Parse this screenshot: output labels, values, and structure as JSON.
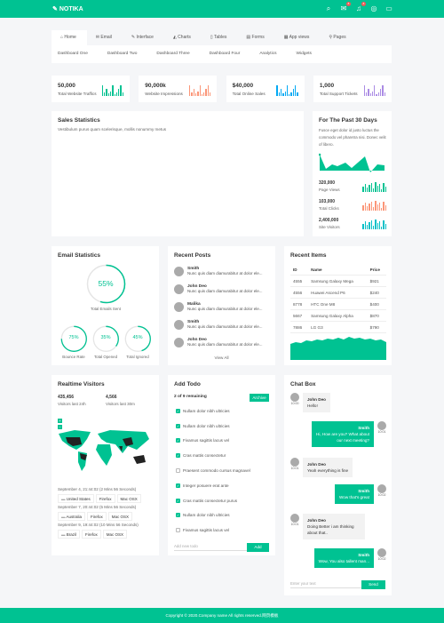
{
  "brand": "NOTIKA",
  "header": {
    "icons": [
      "search-icon",
      "mail-icon",
      "bell-icon",
      "help-icon",
      "chat-icon"
    ],
    "mail_badge": "8",
    "bell_badge": "8"
  },
  "tabs": [
    {
      "label": "Home",
      "icon": "home-icon"
    },
    {
      "label": "Email",
      "icon": "mail-icon"
    },
    {
      "label": "Interface",
      "icon": "edit-icon"
    },
    {
      "label": "Charts",
      "icon": "chart-icon"
    },
    {
      "label": "Tables",
      "icon": "table-icon"
    },
    {
      "label": "Forms",
      "icon": "form-icon"
    },
    {
      "label": "App views",
      "icon": "grid-icon"
    },
    {
      "label": "Pages",
      "icon": "page-icon"
    }
  ],
  "subnav": [
    "Dashboard One",
    "Dashboard Two",
    "Dashboard Three",
    "Dashboard Four",
    "Analytics",
    "Widgets"
  ],
  "stats": [
    {
      "value": "50,000",
      "label": "Total Website Traffics",
      "color": "#00c292"
    },
    {
      "value": "90,000k",
      "label": "Website Impressions",
      "color": "#fb9678"
    },
    {
      "value": "$40,000",
      "label": "Total Online Sales",
      "color": "#03a9f3"
    },
    {
      "value": "1,000",
      "label": "Total Support Tickets",
      "color": "#ab8ce4"
    }
  ],
  "sales": {
    "title": "Sales Statistics",
    "subtitle": "Vestibulum purus quam scelerisque, mollis nonummy metus"
  },
  "past30": {
    "title": "For The Past 30 Days",
    "text": "Fusce eget dolor id justo luctus the commodo vel pharetra nisi. Donec velit of libero.",
    "items": [
      {
        "value": "320,000",
        "label": "Page Views",
        "color": "#00c292"
      },
      {
        "value": "103,000",
        "label": "Total Clicks",
        "color": "#fb9678"
      },
      {
        "value": "2,400,000",
        "label": "Site Visitors",
        "color": "#01c0c8"
      }
    ]
  },
  "email_stats": {
    "title": "Email Statistics",
    "main": {
      "value": "55%",
      "label": "Total Emails Sent",
      "pct": 55
    },
    "small": [
      {
        "value": "75%",
        "label": "Bounce Rate",
        "pct": 75
      },
      {
        "value": "35%",
        "label": "Total Opened",
        "pct": 35
      },
      {
        "value": "45%",
        "label": "Total Ignored",
        "pct": 45
      }
    ]
  },
  "posts": {
    "title": "Recent Posts",
    "items": [
      {
        "name": "Smith",
        "text": "Nunc quis diam diamurabitur at dolor ele..."
      },
      {
        "name": "John Deo",
        "text": "Nunc quis diam diamurabitur at dolor ele..."
      },
      {
        "name": "Malika",
        "text": "Nunc quis diam diamurabitur at dolor ele..."
      },
      {
        "name": "Smith",
        "text": "Nunc quis diam diamurabitur at dolor ele..."
      },
      {
        "name": "John Deo",
        "text": "Nunc quis diam diamurabitur at dolor ele..."
      }
    ],
    "view_all": "View All"
  },
  "items": {
    "title": "Recent Items",
    "headers": [
      "ID",
      "Name",
      "Price"
    ],
    "rows": [
      [
        "4555",
        "Samsung Galaxy Mega",
        "$921"
      ],
      [
        "4556",
        "Huawei Ascend P6",
        "$240"
      ],
      [
        "8778",
        "HTC One M8",
        "$400"
      ],
      [
        "5667",
        "Samsung Galaxy Alpha",
        "$870"
      ],
      [
        "7886",
        "LG G3",
        "$790"
      ]
    ]
  },
  "visitors": {
    "title": "Realtime Visitors",
    "stats": [
      {
        "value": "435,456",
        "label": "Visitors last 24h"
      },
      {
        "value": "4,566",
        "label": "Visitors last 30m"
      }
    ],
    "zoom_in": "+",
    "zoom_out": "−",
    "log": [
      {
        "time": "September 4, 21:44:02 (2 Mins 56 Seconds)",
        "country": "United States",
        "browser": "Firefox",
        "os": "Mac OSX"
      },
      {
        "time": "September 7, 20:44:02 (5 Mins 56 Seconds)",
        "country": "Australia",
        "browser": "Firefox",
        "os": "Mac OSX"
      },
      {
        "time": "September 9, 19:44:02 (10 Mins 56 Seconds)",
        "country": "Brazil",
        "browser": "Firefox",
        "os": "Mac OSX"
      }
    ]
  },
  "todo": {
    "title": "Add Todo",
    "remaining": "2 of 9 remaining",
    "archive": "Archive",
    "items": [
      {
        "text": "Nullam dolor nibh ultricies",
        "done": true
      },
      {
        "text": "Nullam dolor nibh ultricies",
        "done": true
      },
      {
        "text": "Fivamus sagittis lacus vel",
        "done": true
      },
      {
        "text": "Cras mattis consectetur",
        "done": true
      },
      {
        "text": "Praesent commodo cursus magnavel",
        "done": false
      },
      {
        "text": "Integer posuere erat ante",
        "done": true
      },
      {
        "text": "Cras mattis consectetur purus",
        "done": true
      },
      {
        "text": "Nullam dolor nibh ultricies",
        "done": true
      },
      {
        "text": "Fivamus sagittis lacus vel",
        "done": false
      }
    ],
    "placeholder": "Add new todo",
    "add": "Add"
  },
  "chat": {
    "title": "Chat Box",
    "messages": [
      {
        "from": "John Deo",
        "text": "Hello!",
        "time": "10:00",
        "side": "in"
      },
      {
        "from": "Smith",
        "text": "Hi, How are you? What about our next meeting?",
        "time": "10:01",
        "side": "out"
      },
      {
        "from": "John Deo",
        "text": "Yeah everything is fine",
        "time": "10:01",
        "side": "in"
      },
      {
        "from": "Smith",
        "text": "Wow that's great",
        "time": "10:02",
        "side": "out"
      },
      {
        "from": "John Deo",
        "text": "Doing Better i am thinking about that..",
        "time": "10:01",
        "side": "in"
      },
      {
        "from": "Smith",
        "text": "Wow, You also tallent man...",
        "time": "10:02",
        "side": "out"
      }
    ],
    "placeholder": "Enter your text",
    "send": "Send"
  },
  "footer": "Copyright © 2020.Company name All rights reserved.网页模板",
  "accent": "#00c292"
}
